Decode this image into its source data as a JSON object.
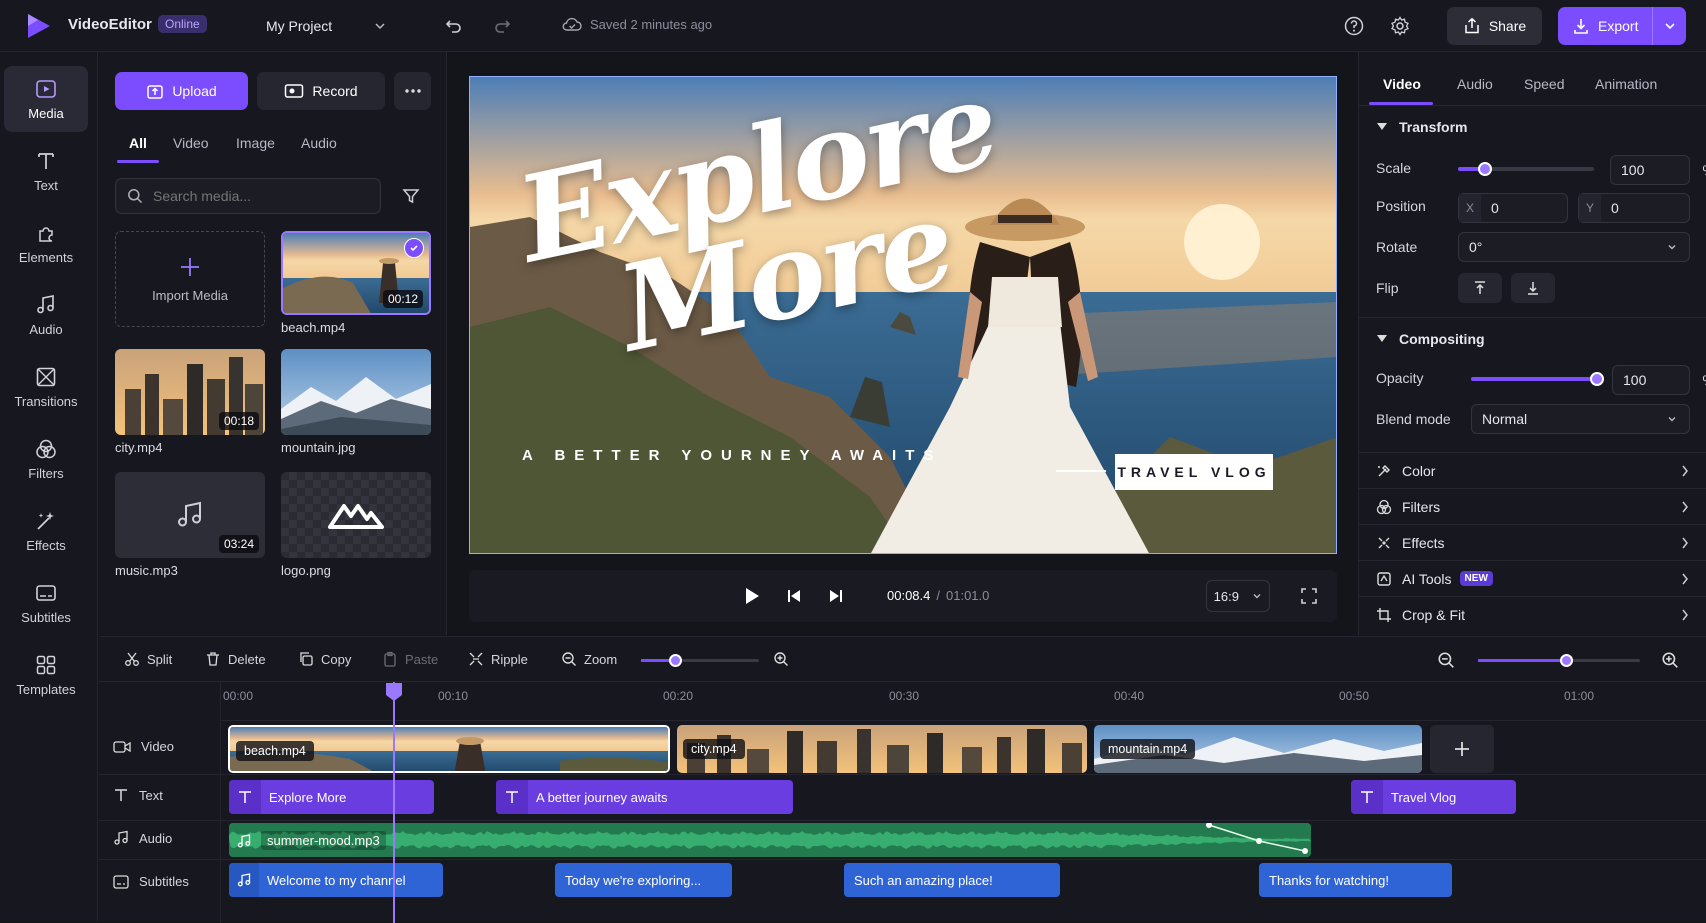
{
  "app": {
    "name": "VideoEditor",
    "badge": "Online",
    "project": "My Project",
    "saved_status": "Saved 2 minutes ago",
    "share_label": "Share",
    "export_label": "Export"
  },
  "rail": {
    "items": [
      {
        "label": "Media",
        "icon": "media-icon"
      },
      {
        "label": "Text",
        "icon": "text-icon"
      },
      {
        "label": "Elements",
        "icon": "elements-icon"
      },
      {
        "label": "Audio",
        "icon": "audio-icon"
      },
      {
        "label": "Transitions",
        "icon": "transitions-icon"
      },
      {
        "label": "Filters",
        "icon": "filters-icon"
      },
      {
        "label": "Effects",
        "icon": "effects-icon"
      },
      {
        "label": "Subtitles",
        "icon": "subtitles-icon"
      },
      {
        "label": "Templates",
        "icon": "templates-icon"
      }
    ]
  },
  "media": {
    "upload_label": "Upload",
    "record_label": "Record",
    "tabs": [
      "All",
      "Video",
      "Image",
      "Audio"
    ],
    "search_placeholder": "Search media...",
    "import_label": "Import Media",
    "items": [
      {
        "name": "beach.mp4",
        "duration": "00:12"
      },
      {
        "name": "city.mp4",
        "duration": "00:18"
      },
      {
        "name": "mountain.jpg",
        "duration": ""
      },
      {
        "name": "music.mp3",
        "duration": "03:24"
      },
      {
        "name": "logo.png",
        "duration": ""
      }
    ]
  },
  "preview": {
    "title_line1": "Explore",
    "title_line2": "More",
    "tagline": "A BETTER YOURNEY AWAITS",
    "badge": "TRAVEL VLOG",
    "current_time": "00:08.4",
    "separator": "/",
    "total_time": "01:01.0",
    "aspect": "16:9"
  },
  "props": {
    "tabs": [
      "Video",
      "Audio",
      "Speed",
      "Animation"
    ],
    "transform_title": "Transform",
    "scale_label": "Scale",
    "scale_value": "100",
    "scale_unit": "%",
    "scale_level": 0.2,
    "position_label": "Position",
    "x_label": "X",
    "x_value": "0",
    "y_label": "Y",
    "y_value": "0",
    "rotate_label": "Rotate",
    "rotate_value": "0°",
    "flip_label": "Flip",
    "compositing_title": "Compositing",
    "opacity_label": "Opacity",
    "opacity_value": "100",
    "opacity_unit": "%",
    "opacity_level": 1.0,
    "blend_label": "Blend mode",
    "blend_value": "Normal",
    "sections": [
      {
        "label": "Color",
        "icon": "color-icon"
      },
      {
        "label": "Filters",
        "icon": "filters-icon"
      },
      {
        "label": "Effects",
        "icon": "effects-icon"
      },
      {
        "label": "AI Tools",
        "icon": "ai-tools-icon",
        "badge": "NEW"
      },
      {
        "label": "Crop & Fit",
        "icon": "crop-icon"
      }
    ]
  },
  "timeline": {
    "tools": [
      "Split",
      "Delete",
      "Copy",
      "Paste",
      "Ripple",
      "Zoom"
    ],
    "zoom_level": 0.3,
    "view_zoom_level": 0.55,
    "ticks": [
      "00:00",
      "00:10",
      "00:20",
      "00:30",
      "00:40",
      "00:50",
      "01:00"
    ],
    "tracks": [
      "Video",
      "Text",
      "Audio",
      "Subtitles"
    ],
    "video_clips": [
      "beach.mp4",
      "city.mp4",
      "mountain.mp4"
    ],
    "text_clips": [
      "Explore More",
      "A better journey awaits",
      "Travel Vlog"
    ],
    "audio_clip": "summer-mood.mp3",
    "subtitle_clips": [
      "Welcome to my channel",
      "Today we're exploring...",
      "Such an amazing place!",
      "Thanks for watching!"
    ]
  },
  "colors": {
    "accent": "#7b4dff",
    "text_clip": "#6a3de0",
    "subtitle_clip": "#2f64d6",
    "audio_clip": "#2f9a5e"
  }
}
